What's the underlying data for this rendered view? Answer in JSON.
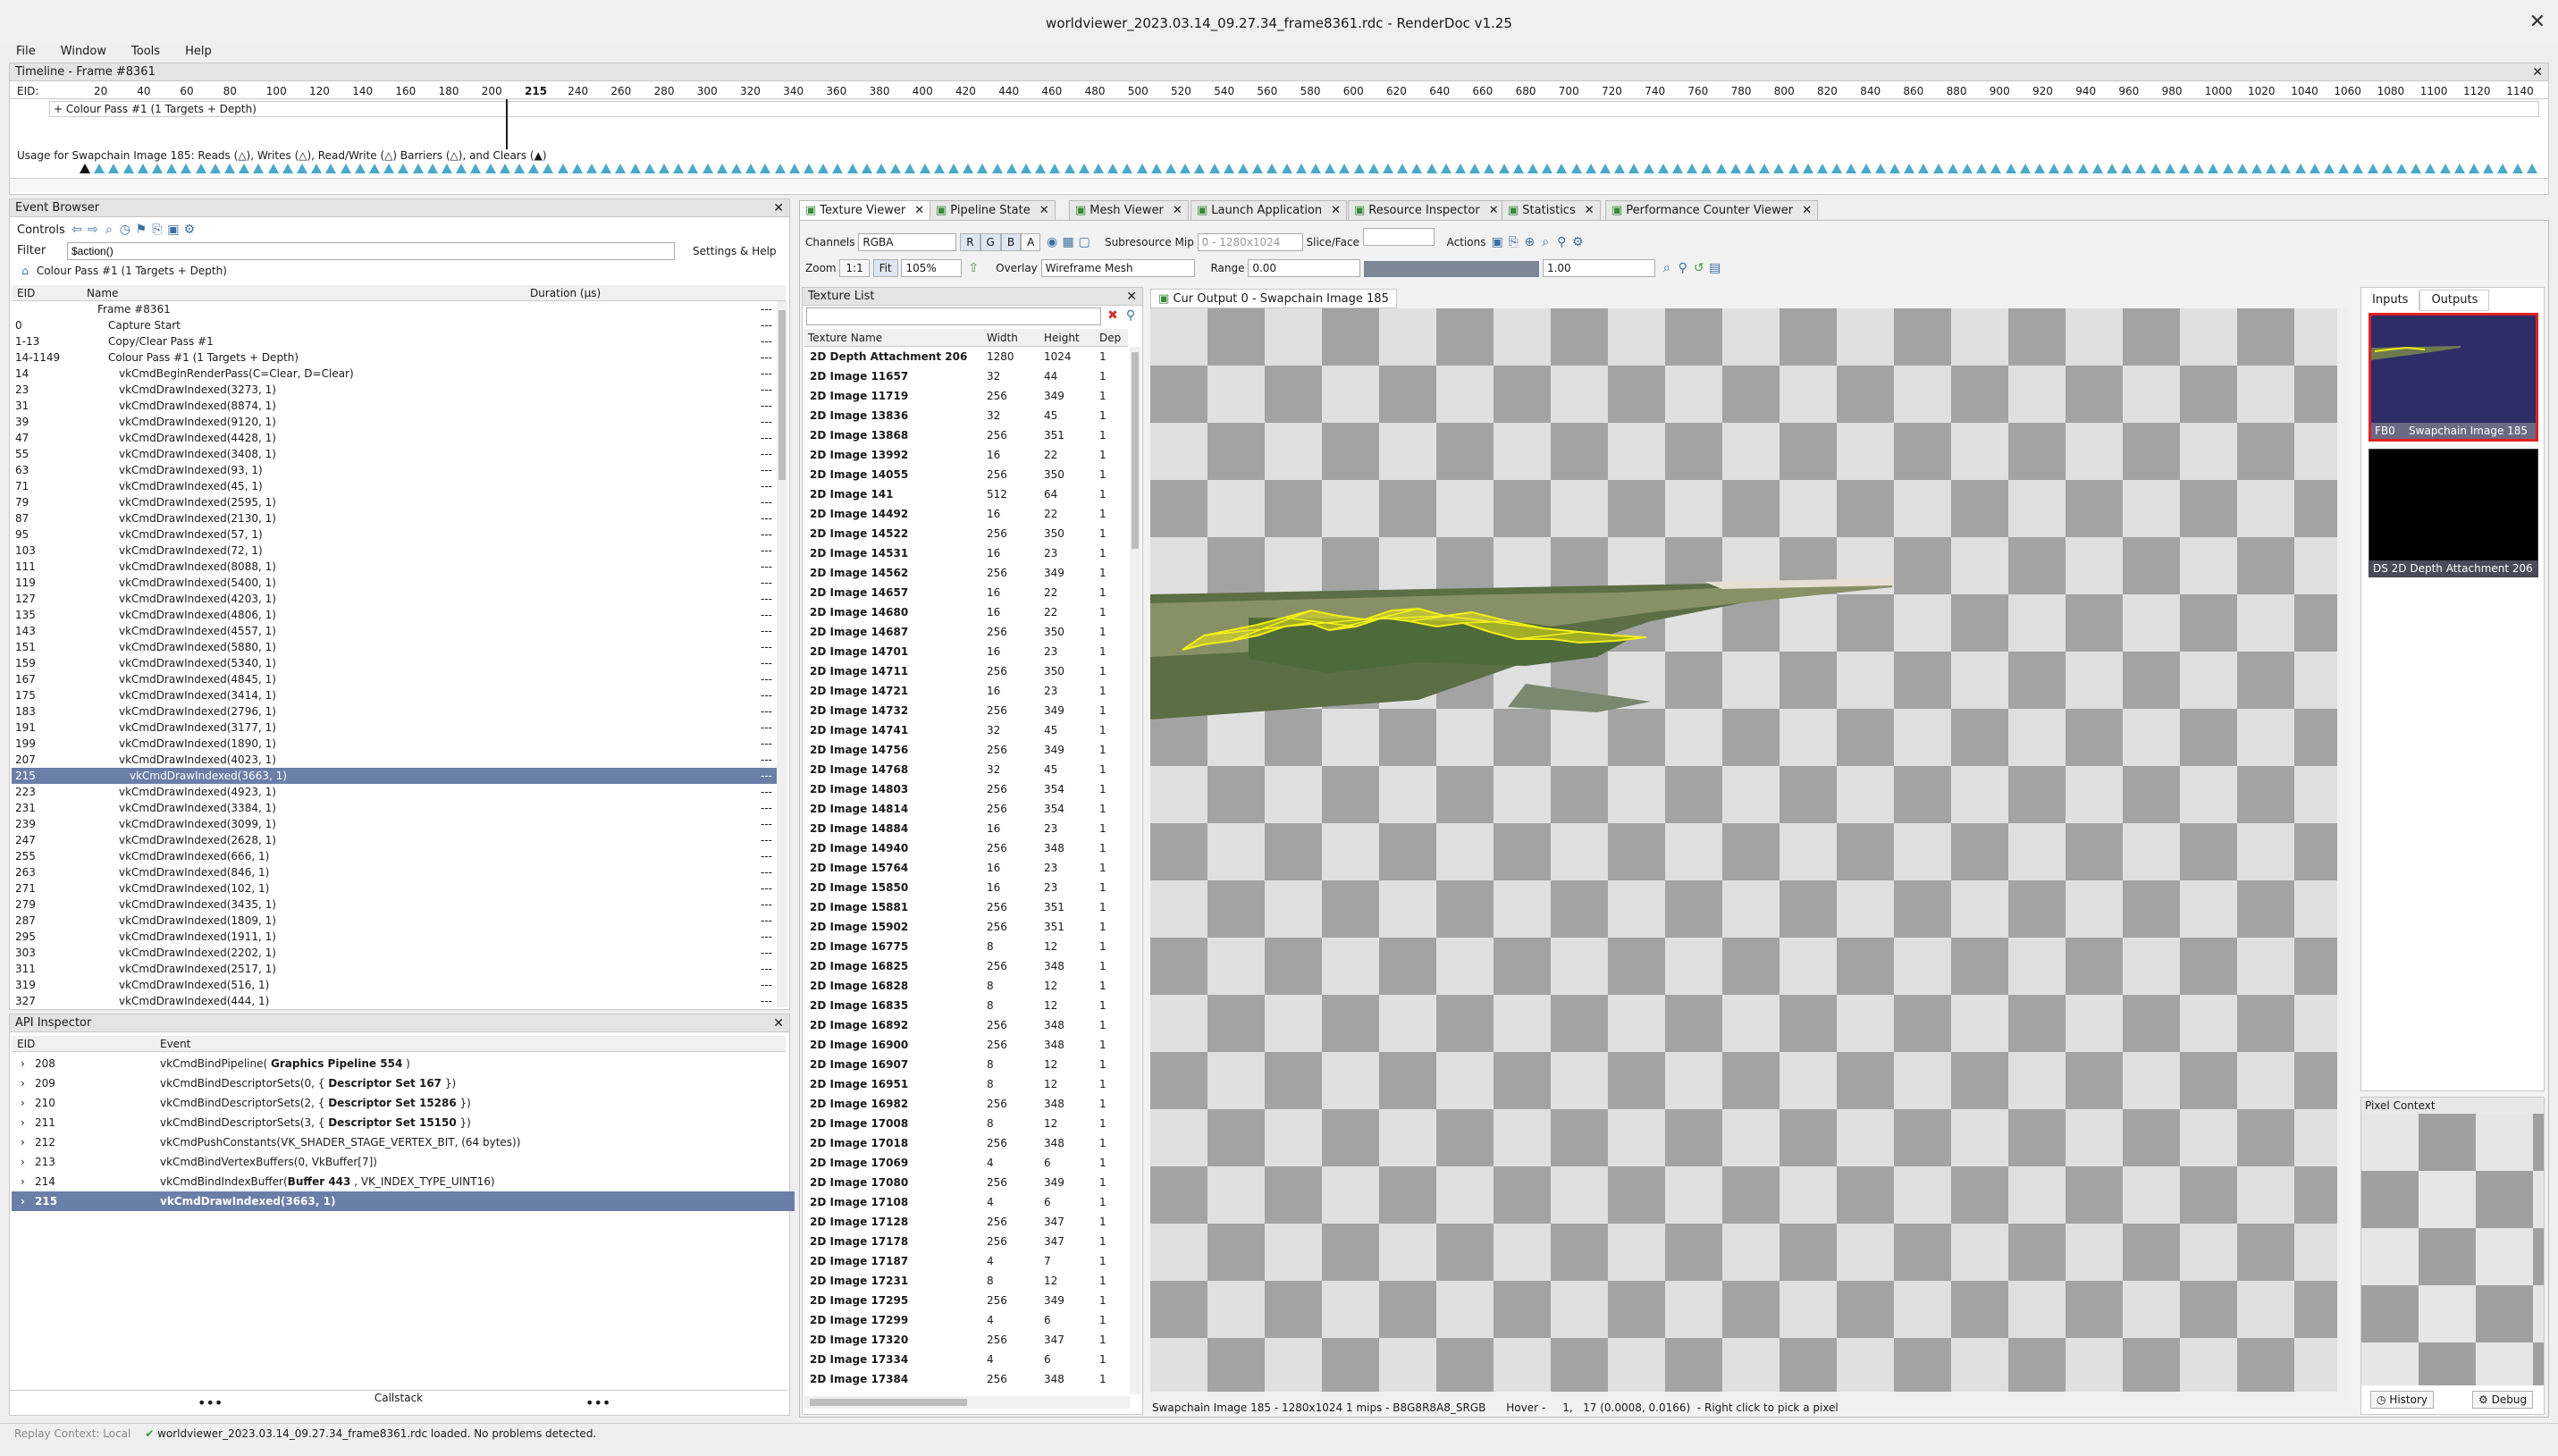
{
  "window": {
    "title": "worldviewer_2023.03.14_09.27.34_frame8361.rdc - RenderDoc v1.25",
    "close_glyph": "✕"
  },
  "menu": [
    "File",
    "Window",
    "Tools",
    "Help"
  ],
  "timeline": {
    "title": "Timeline - Frame #8361",
    "eid_label": "EID:",
    "ticks": [
      "20",
      "40",
      "60",
      "80",
      "100",
      "120",
      "140",
      "160",
      "180",
      "200",
      "215",
      "240",
      "260",
      "280",
      "300",
      "320",
      "340",
      "360",
      "380",
      "400",
      "420",
      "440",
      "460",
      "480",
      "500",
      "520",
      "540",
      "560",
      "580",
      "600",
      "620",
      "640",
      "660",
      "680",
      "700",
      "720",
      "740",
      "760",
      "780",
      "800",
      "820",
      "840",
      "860",
      "880",
      "900",
      "920",
      "940",
      "960",
      "980",
      "1000",
      "1020",
      "1040",
      "1060",
      "1080",
      "1100",
      "1120",
      "1140"
    ],
    "current_eid": "215",
    "pass_label": "+ Colour Pass #1 (1 Targets + Depth)",
    "usage_label": "Usage for Swapchain Image 185: Reads (△), Writes (△), Read/Write (△) Barriers (△), and Clears (▲)"
  },
  "event_browser": {
    "title": "Event Browser",
    "controls_label": "Controls",
    "filter_label": "Filter",
    "filter_value": "$action()",
    "settings_label": "Settings & Help",
    "breadcrumb": "Colour Pass #1 (1 Targets + Depth)",
    "col_eid": "EID",
    "col_name": "Name",
    "col_duration": "Duration (µs)",
    "rows": [
      {
        "eid": "",
        "name": "Frame #8361",
        "indent": 1,
        "dur": "---"
      },
      {
        "eid": "0",
        "name": "Capture Start",
        "indent": 2,
        "dur": "---"
      },
      {
        "eid": "1-13",
        "name": "Copy/Clear Pass #1",
        "indent": 2,
        "dur": "---"
      },
      {
        "eid": "14-1149",
        "name": "Colour Pass #1 (1 Targets + Depth)",
        "indent": 2,
        "dur": "---"
      },
      {
        "eid": "14",
        "name": "vkCmdBeginRenderPass(C=Clear, D=Clear)",
        "indent": 3,
        "dur": "---"
      },
      {
        "eid": "23",
        "name": "vkCmdDrawIndexed(3273, 1)",
        "indent": 3,
        "dur": "---"
      },
      {
        "eid": "31",
        "name": "vkCmdDrawIndexed(8874, 1)",
        "indent": 3,
        "dur": "---"
      },
      {
        "eid": "39",
        "name": "vkCmdDrawIndexed(9120, 1)",
        "indent": 3,
        "dur": "---"
      },
      {
        "eid": "47",
        "name": "vkCmdDrawIndexed(4428, 1)",
        "indent": 3,
        "dur": "---"
      },
      {
        "eid": "55",
        "name": "vkCmdDrawIndexed(3408, 1)",
        "indent": 3,
        "dur": "---"
      },
      {
        "eid": "63",
        "name": "vkCmdDrawIndexed(93, 1)",
        "indent": 3,
        "dur": "---"
      },
      {
        "eid": "71",
        "name": "vkCmdDrawIndexed(45, 1)",
        "indent": 3,
        "dur": "---"
      },
      {
        "eid": "79",
        "name": "vkCmdDrawIndexed(2595, 1)",
        "indent": 3,
        "dur": "---"
      },
      {
        "eid": "87",
        "name": "vkCmdDrawIndexed(2130, 1)",
        "indent": 3,
        "dur": "---"
      },
      {
        "eid": "95",
        "name": "vkCmdDrawIndexed(57, 1)",
        "indent": 3,
        "dur": "---"
      },
      {
        "eid": "103",
        "name": "vkCmdDrawIndexed(72, 1)",
        "indent": 3,
        "dur": "---"
      },
      {
        "eid": "111",
        "name": "vkCmdDrawIndexed(8088, 1)",
        "indent": 3,
        "dur": "---"
      },
      {
        "eid": "119",
        "name": "vkCmdDrawIndexed(5400, 1)",
        "indent": 3,
        "dur": "---"
      },
      {
        "eid": "127",
        "name": "vkCmdDrawIndexed(4203, 1)",
        "indent": 3,
        "dur": "---"
      },
      {
        "eid": "135",
        "name": "vkCmdDrawIndexed(4806, 1)",
        "indent": 3,
        "dur": "---"
      },
      {
        "eid": "143",
        "name": "vkCmdDrawIndexed(4557, 1)",
        "indent": 3,
        "dur": "---"
      },
      {
        "eid": "151",
        "name": "vkCmdDrawIndexed(5880, 1)",
        "indent": 3,
        "dur": "---"
      },
      {
        "eid": "159",
        "name": "vkCmdDrawIndexed(5340, 1)",
        "indent": 3,
        "dur": "---"
      },
      {
        "eid": "167",
        "name": "vkCmdDrawIndexed(4845, 1)",
        "indent": 3,
        "dur": "---"
      },
      {
        "eid": "175",
        "name": "vkCmdDrawIndexed(3414, 1)",
        "indent": 3,
        "dur": "---"
      },
      {
        "eid": "183",
        "name": "vkCmdDrawIndexed(2796, 1)",
        "indent": 3,
        "dur": "---"
      },
      {
        "eid": "191",
        "name": "vkCmdDrawIndexed(3177, 1)",
        "indent": 3,
        "dur": "---"
      },
      {
        "eid": "199",
        "name": "vkCmdDrawIndexed(1890, 1)",
        "indent": 3,
        "dur": "---"
      },
      {
        "eid": "207",
        "name": "vkCmdDrawIndexed(4023, 1)",
        "indent": 3,
        "dur": "---"
      },
      {
        "eid": "215",
        "name": "vkCmdDrawIndexed(3663, 1)",
        "indent": 4,
        "dur": "---",
        "selected": true
      },
      {
        "eid": "223",
        "name": "vkCmdDrawIndexed(4923, 1)",
        "indent": 3,
        "dur": "---"
      },
      {
        "eid": "231",
        "name": "vkCmdDrawIndexed(3384, 1)",
        "indent": 3,
        "dur": "---"
      },
      {
        "eid": "239",
        "name": "vkCmdDrawIndexed(3099, 1)",
        "indent": 3,
        "dur": "---"
      },
      {
        "eid": "247",
        "name": "vkCmdDrawIndexed(2628, 1)",
        "indent": 3,
        "dur": "---"
      },
      {
        "eid": "255",
        "name": "vkCmdDrawIndexed(666, 1)",
        "indent": 3,
        "dur": "---"
      },
      {
        "eid": "263",
        "name": "vkCmdDrawIndexed(846, 1)",
        "indent": 3,
        "dur": "---"
      },
      {
        "eid": "271",
        "name": "vkCmdDrawIndexed(102, 1)",
        "indent": 3,
        "dur": "---"
      },
      {
        "eid": "279",
        "name": "vkCmdDrawIndexed(3435, 1)",
        "indent": 3,
        "dur": "---"
      },
      {
        "eid": "287",
        "name": "vkCmdDrawIndexed(1809, 1)",
        "indent": 3,
        "dur": "---"
      },
      {
        "eid": "295",
        "name": "vkCmdDrawIndexed(1911, 1)",
        "indent": 3,
        "dur": "---"
      },
      {
        "eid": "303",
        "name": "vkCmdDrawIndexed(2202, 1)",
        "indent": 3,
        "dur": "---"
      },
      {
        "eid": "311",
        "name": "vkCmdDrawIndexed(2517, 1)",
        "indent": 3,
        "dur": "---"
      },
      {
        "eid": "319",
        "name": "vkCmdDrawIndexed(516, 1)",
        "indent": 3,
        "dur": "---"
      },
      {
        "eid": "327",
        "name": "vkCmdDrawIndexed(444, 1)",
        "indent": 3,
        "dur": "---"
      }
    ]
  },
  "api_inspector": {
    "title": "API Inspector",
    "col_eid": "EID",
    "col_event": "Event",
    "rows": [
      {
        "eid": "208",
        "pre": "vkCmdBindPipeline( ",
        "bold": "Graphics Pipeline 554",
        "post": " )"
      },
      {
        "eid": "209",
        "pre": "vkCmdBindDescriptorSets(0, {  ",
        "bold": "Descriptor Set 167",
        "post": "  })"
      },
      {
        "eid": "210",
        "pre": "vkCmdBindDescriptorSets(2, {  ",
        "bold": "Descriptor Set 15286",
        "post": "  })"
      },
      {
        "eid": "211",
        "pre": "vkCmdBindDescriptorSets(3, {  ",
        "bold": "Descriptor Set 15150",
        "post": "  })"
      },
      {
        "eid": "212",
        "pre": "vkCmdPushConstants(VK_SHADER_STAGE_VERTEX_BIT, (64 bytes))",
        "bold": "",
        "post": ""
      },
      {
        "eid": "213",
        "pre": "vkCmdBindVertexBuffers(0, VkBuffer[7])",
        "bold": "",
        "post": ""
      },
      {
        "eid": "214",
        "pre": "vkCmdBindIndexBuffer(",
        "bold": "Buffer 443",
        "post": " , VK_INDEX_TYPE_UINT16)"
      },
      {
        "eid": "215",
        "pre": "vkCmdDrawIndexed(3663, 1)",
        "bold": "",
        "post": "",
        "selected": true
      }
    ],
    "callstack_label": "Callstack"
  },
  "tabs": [
    "Texture Viewer",
    "Pipeline State",
    "Mesh Viewer",
    "Launch Application",
    "Resource Inspector",
    "Statistics",
    "Performance Counter Viewer"
  ],
  "toolbar": {
    "channels_label": "Channels",
    "channels_value": "RGBA",
    "r": "R",
    "g": "G",
    "b": "B",
    "a": "A",
    "subresource_label": "Subresource",
    "mip_label": "Mip",
    "mip_value": "0 - 1280x1024",
    "slice_label": "Slice/Face",
    "actions_label": "Actions",
    "zoom_label": "Zoom",
    "zoom_11": "1:1",
    "fit_label": "Fit",
    "zoom_value": "105%",
    "overlay_label": "Overlay",
    "overlay_value": "Wireframe Mesh",
    "range_label": "Range",
    "range_min": "0.00",
    "range_max": "1.00"
  },
  "texture_list": {
    "title": "Texture List",
    "col_name": "Texture Name",
    "col_width": "Width",
    "col_height": "Height",
    "col_depth": "Dep",
    "rows": [
      {
        "name": "2D Depth Attachment 206",
        "w": "1280",
        "h": "1024",
        "d": "1"
      },
      {
        "name": "2D Image 11657",
        "w": "32",
        "h": "44",
        "d": "1"
      },
      {
        "name": "2D Image 11719",
        "w": "256",
        "h": "349",
        "d": "1"
      },
      {
        "name": "2D Image 13836",
        "w": "32",
        "h": "45",
        "d": "1"
      },
      {
        "name": "2D Image 13868",
        "w": "256",
        "h": "351",
        "d": "1"
      },
      {
        "name": "2D Image 13992",
        "w": "16",
        "h": "22",
        "d": "1"
      },
      {
        "name": "2D Image 14055",
        "w": "256",
        "h": "350",
        "d": "1"
      },
      {
        "name": "2D Image 141",
        "w": "512",
        "h": "64",
        "d": "1"
      },
      {
        "name": "2D Image 14492",
        "w": "16",
        "h": "22",
        "d": "1"
      },
      {
        "name": "2D Image 14522",
        "w": "256",
        "h": "350",
        "d": "1"
      },
      {
        "name": "2D Image 14531",
        "w": "16",
        "h": "23",
        "d": "1"
      },
      {
        "name": "2D Image 14562",
        "w": "256",
        "h": "349",
        "d": "1"
      },
      {
        "name": "2D Image 14657",
        "w": "16",
        "h": "22",
        "d": "1"
      },
      {
        "name": "2D Image 14680",
        "w": "16",
        "h": "22",
        "d": "1"
      },
      {
        "name": "2D Image 14687",
        "w": "256",
        "h": "350",
        "d": "1"
      },
      {
        "name": "2D Image 14701",
        "w": "16",
        "h": "23",
        "d": "1"
      },
      {
        "name": "2D Image 14711",
        "w": "256",
        "h": "350",
        "d": "1"
      },
      {
        "name": "2D Image 14721",
        "w": "16",
        "h": "23",
        "d": "1"
      },
      {
        "name": "2D Image 14732",
        "w": "256",
        "h": "349",
        "d": "1"
      },
      {
        "name": "2D Image 14741",
        "w": "32",
        "h": "45",
        "d": "1"
      },
      {
        "name": "2D Image 14756",
        "w": "256",
        "h": "349",
        "d": "1"
      },
      {
        "name": "2D Image 14768",
        "w": "32",
        "h": "45",
        "d": "1"
      },
      {
        "name": "2D Image 14803",
        "w": "256",
        "h": "354",
        "d": "1"
      },
      {
        "name": "2D Image 14814",
        "w": "256",
        "h": "354",
        "d": "1"
      },
      {
        "name": "2D Image 14884",
        "w": "16",
        "h": "23",
        "d": "1"
      },
      {
        "name": "2D Image 14940",
        "w": "256",
        "h": "348",
        "d": "1"
      },
      {
        "name": "2D Image 15764",
        "w": "16",
        "h": "23",
        "d": "1"
      },
      {
        "name": "2D Image 15850",
        "w": "16",
        "h": "23",
        "d": "1"
      },
      {
        "name": "2D Image 15881",
        "w": "256",
        "h": "351",
        "d": "1"
      },
      {
        "name": "2D Image 15902",
        "w": "256",
        "h": "351",
        "d": "1"
      },
      {
        "name": "2D Image 16775",
        "w": "8",
        "h": "12",
        "d": "1"
      },
      {
        "name": "2D Image 16825",
        "w": "256",
        "h": "348",
        "d": "1"
      },
      {
        "name": "2D Image 16828",
        "w": "8",
        "h": "12",
        "d": "1"
      },
      {
        "name": "2D Image 16835",
        "w": "8",
        "h": "12",
        "d": "1"
      },
      {
        "name": "2D Image 16892",
        "w": "256",
        "h": "348",
        "d": "1"
      },
      {
        "name": "2D Image 16900",
        "w": "256",
        "h": "348",
        "d": "1"
      },
      {
        "name": "2D Image 16907",
        "w": "8",
        "h": "12",
        "d": "1"
      },
      {
        "name": "2D Image 16951",
        "w": "8",
        "h": "12",
        "d": "1"
      },
      {
        "name": "2D Image 16982",
        "w": "256",
        "h": "348",
        "d": "1"
      },
      {
        "name": "2D Image 17008",
        "w": "8",
        "h": "12",
        "d": "1"
      },
      {
        "name": "2D Image 17018",
        "w": "256",
        "h": "348",
        "d": "1"
      },
      {
        "name": "2D Image 17069",
        "w": "4",
        "h": "6",
        "d": "1"
      },
      {
        "name": "2D Image 17080",
        "w": "256",
        "h": "349",
        "d": "1"
      },
      {
        "name": "2D Image 17108",
        "w": "4",
        "h": "6",
        "d": "1"
      },
      {
        "name": "2D Image 17128",
        "w": "256",
        "h": "347",
        "d": "1"
      },
      {
        "name": "2D Image 17178",
        "w": "256",
        "h": "347",
        "d": "1"
      },
      {
        "name": "2D Image 17187",
        "w": "4",
        "h": "7",
        "d": "1"
      },
      {
        "name": "2D Image 17231",
        "w": "8",
        "h": "12",
        "d": "1"
      },
      {
        "name": "2D Image 17295",
        "w": "256",
        "h": "349",
        "d": "1"
      },
      {
        "name": "2D Image 17299",
        "w": "4",
        "h": "6",
        "d": "1"
      },
      {
        "name": "2D Image 17320",
        "w": "256",
        "h": "347",
        "d": "1"
      },
      {
        "name": "2D Image 17334",
        "w": "4",
        "h": "6",
        "d": "1"
      },
      {
        "name": "2D Image 17384",
        "w": "256",
        "h": "348",
        "d": "1"
      }
    ]
  },
  "viewport": {
    "tab_label": "Cur Output 0 - Swapchain Image 185",
    "bg_color": "#2d2d68",
    "status": "Swapchain Image 185 - 1280x1024 1 mips - B8G8R8A8_SRGB      Hover -     1,   17 (0.0008, 0.0166)  - Right click to pick a pixel"
  },
  "thumbnails": {
    "inputs_tab": "Inputs",
    "outputs_tab": "Outputs",
    "items": [
      {
        "label": "FB0    Swapchain Image 185"
      },
      {
        "label": "DS 2D Depth Attachment 206"
      }
    ],
    "pixel_context": "Pixel Context",
    "history": "History",
    "debug": "Debug"
  },
  "statusbar": {
    "context": "Replay Context: Local",
    "message": "worldviewer_2023.03.14_09.27.34_frame8361.rdc loaded. No problems detected."
  }
}
